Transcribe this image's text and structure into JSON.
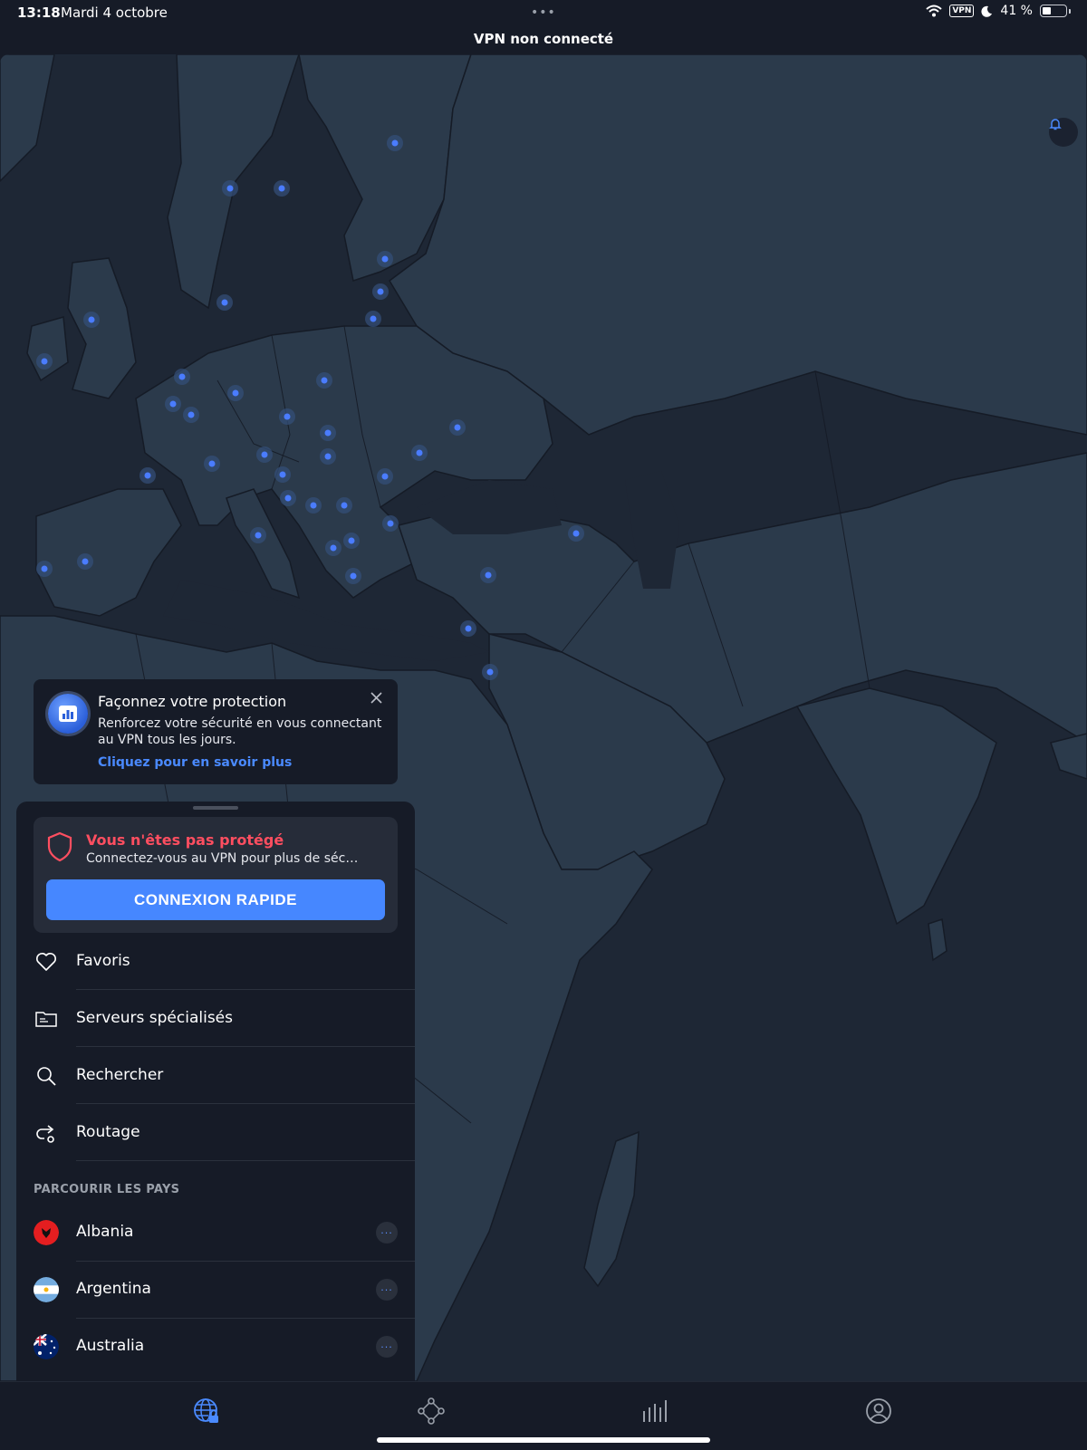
{
  "status_bar": {
    "time": "13:18",
    "date": "Mardi 4 octobre",
    "dots": "•••",
    "vpn_badge": "VPN",
    "battery_text": "41 %",
    "battery_level": 0.41
  },
  "window": {
    "title": "VPN non connecté"
  },
  "colors": {
    "accent": "#4687ff",
    "danger": "#ff4e60",
    "map_land": "#2b3a4b",
    "map_sea": "#1e2735",
    "server_dot": "#4a7cff"
  },
  "map": {
    "bell_icon": "bell-icon"
  },
  "promo": {
    "title": "Façonnez votre protection",
    "body": "Renforcez votre sécurité en vous connectant au VPN tous les jours.",
    "link": "Cliquez pour en savoir plus"
  },
  "protection": {
    "title": "Vous n'êtes pas protégé",
    "subtitle": "Connectez-vous au VPN pour plus de séc…",
    "button": "CONNEXION RAPIDE"
  },
  "menu": {
    "items": [
      {
        "label": "Favoris",
        "icon": "heart-icon"
      },
      {
        "label": "Serveurs spécialisés",
        "icon": "folder-icon"
      },
      {
        "label": "Rechercher",
        "icon": "search-icon"
      },
      {
        "label": "Routage",
        "icon": "route-icon"
      }
    ]
  },
  "countries": {
    "header": "PARCOURIR LES PAYS",
    "items": [
      {
        "name": "Albania",
        "flag": "albania-flag-icon"
      },
      {
        "name": "Argentina",
        "flag": "argentina-flag-icon"
      },
      {
        "name": "Australia",
        "flag": "australia-flag-icon"
      }
    ],
    "more_label": "···"
  },
  "bottom_nav": {
    "tabs": [
      {
        "icon": "globe-lock-icon",
        "active": true
      },
      {
        "icon": "meshnet-icon",
        "active": false
      },
      {
        "icon": "stats-icon",
        "active": false
      },
      {
        "icon": "profile-icon",
        "active": false
      }
    ]
  }
}
